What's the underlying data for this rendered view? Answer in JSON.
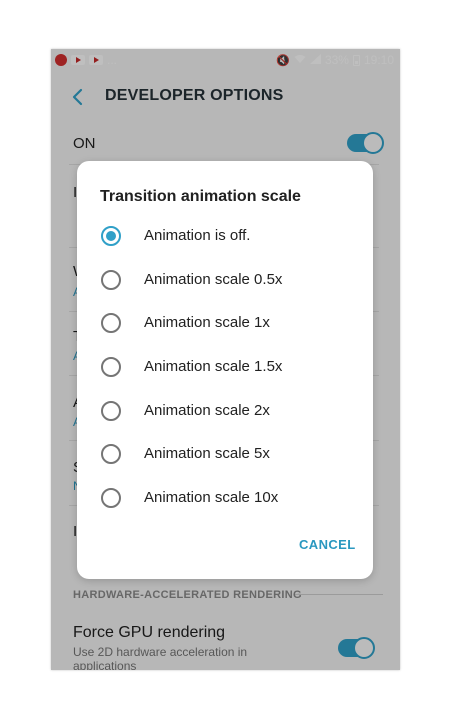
{
  "status_bar": {
    "notifications": [
      "bug-icon",
      "youtube-icon",
      "youtube-icon"
    ],
    "overflow": "...",
    "battery_text": "33%",
    "time": "19:10",
    "colors": {
      "bar": "#f5f5f5"
    }
  },
  "app_bar": {
    "title": "DEVELOPER OPTIONS"
  },
  "master_switch": {
    "label": "ON",
    "state": true
  },
  "background_rows": [
    {
      "title": "I",
      "subtitle": ""
    },
    {
      "title": "W",
      "subtitle": "A"
    },
    {
      "title": "T",
      "subtitle": "A"
    },
    {
      "title": "A",
      "subtitle": "A"
    },
    {
      "title": "S",
      "subtitle": "N"
    },
    {
      "title": "I",
      "subtitle": ""
    }
  ],
  "section": {
    "header": "HARDWARE-ACCELERATED RENDERING"
  },
  "gpu_setting": {
    "title": "Force GPU rendering",
    "summary": "Use 2D hardware acceleration in applications",
    "state": true
  },
  "dialog": {
    "title": "Transition animation scale",
    "options": [
      {
        "label": "Animation is off.",
        "selected": true
      },
      {
        "label": "Animation scale 0.5x",
        "selected": false
      },
      {
        "label": "Animation scale 1x",
        "selected": false
      },
      {
        "label": "Animation scale 1.5x",
        "selected": false
      },
      {
        "label": "Animation scale 2x",
        "selected": false
      },
      {
        "label": "Animation scale 5x",
        "selected": false
      },
      {
        "label": "Animation scale 10x",
        "selected": false
      }
    ],
    "cancel_label": "CANCEL"
  },
  "colors": {
    "accent": "#30a0c8",
    "text": "#212121",
    "scrim": "rgba(0,0,0,0.25)"
  }
}
